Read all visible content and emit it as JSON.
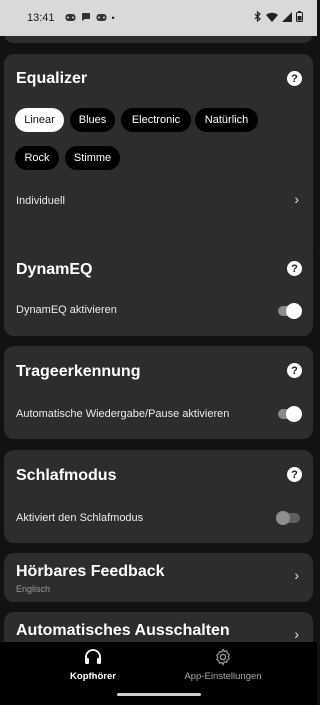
{
  "status": {
    "time": "13:41",
    "notif_icons": [
      "game-icon",
      "chat-icon",
      "game-icon"
    ],
    "dot": "•",
    "right_icons": [
      "bluetooth-icon",
      "wifi-icon",
      "signal-icon",
      "battery-icon"
    ]
  },
  "equalizer": {
    "title": "Equalizer",
    "help": "?",
    "presets": [
      "Linear",
      "Blues",
      "Electronic",
      "Natürlich",
      "Rock",
      "Stimme"
    ],
    "selected": "Linear",
    "custom_label": "Individuell"
  },
  "dynameq": {
    "title": "DynamEQ",
    "help": "?",
    "toggle_label": "DynamEQ aktivieren",
    "enabled": true
  },
  "wear_detection": {
    "title": "Trageerkennung",
    "help": "?",
    "toggle_label": "Automatische Wiedergabe/Pause aktivieren",
    "enabled": true
  },
  "sleep_mode": {
    "title": "Schlafmodus",
    "help": "?",
    "toggle_label": "Aktiviert den Schlafmodus",
    "enabled": false
  },
  "audible_feedback": {
    "title": "Hörbares Feedback",
    "value": "Englisch"
  },
  "auto_off": {
    "title": "Automatisches Ausschalten"
  },
  "nav": {
    "headphones_label": "Kopfhörer",
    "settings_label": "App-Einstellungen"
  },
  "colors": {
    "background": "#121212",
    "card": "#2d2d2d",
    "statusbar": "#d9d9d9",
    "chip": "#000000",
    "chip_selected": "#ffffff"
  }
}
